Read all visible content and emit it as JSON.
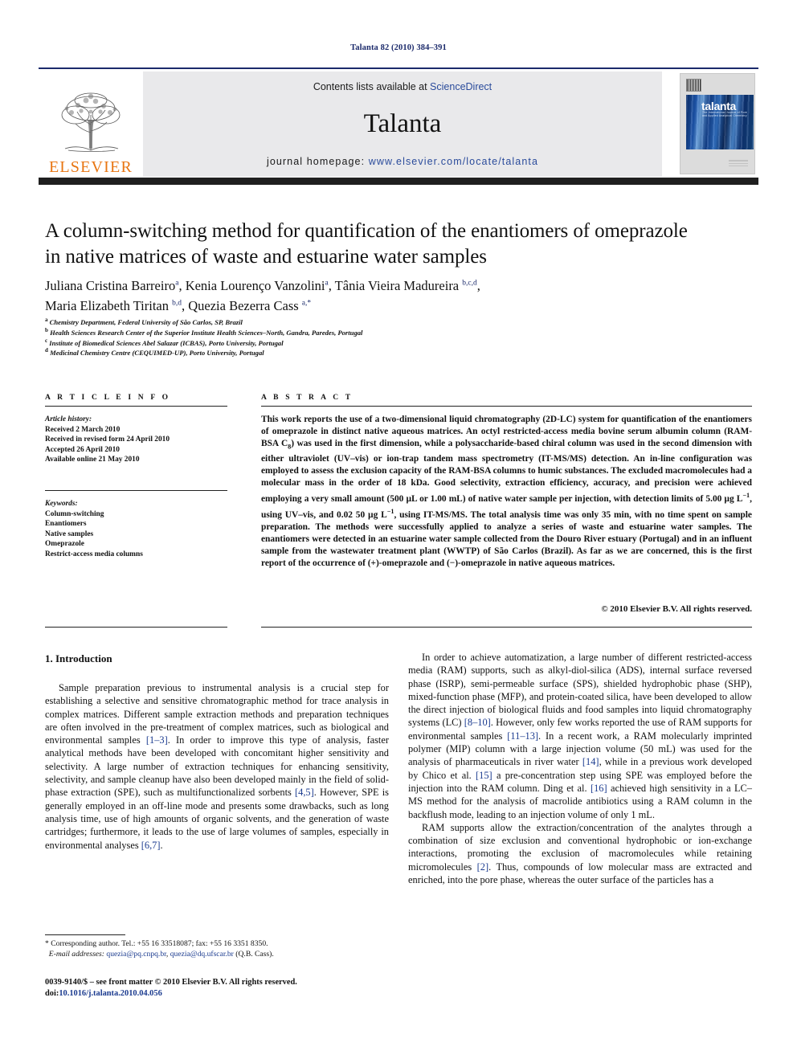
{
  "running_head": "Talanta 82 (2010) 384–391",
  "masthead": {
    "publisher": "ELSEVIER",
    "contents_prefix": "Contents lists available at ",
    "contents_link": "ScienceDirect",
    "journal_name": "Talanta",
    "homepage_prefix": "journal homepage: ",
    "homepage_url": "www.elsevier.com/locate/talanta",
    "cover_title": "talanta",
    "cover_subtitle": "The International Journal of Pure and Applied Analytical Chemistry"
  },
  "article": {
    "title_line1": "A column-switching method for quantification of the enantiomers of omeprazole",
    "title_line2": "in native matrices of waste and estuarine water samples",
    "authors": [
      {
        "name": "Juliana Cristina Barreiro",
        "marks": "a"
      },
      {
        "name": "Kenia Lourenço Vanzolini",
        "marks": "a"
      },
      {
        "name": "Tânia Vieira Madureira",
        "marks": "b,c,d"
      },
      {
        "name": "Maria Elizabeth Tiritan",
        "marks": "b,d"
      },
      {
        "name": "Quezia Bezerra Cass",
        "marks": "a,*"
      }
    ],
    "affiliations": [
      {
        "mark": "a",
        "text": "Chemistry Department, Federal University of São Carlos, SP, Brazil"
      },
      {
        "mark": "b",
        "text": "Health Sciences Research Center of the Superior Institute Health Sciences–North, Gandra, Paredes, Portugal"
      },
      {
        "mark": "c",
        "text": "Institute of Biomedical Sciences Abel Salazar (ICBAS), Porto University, Portugal"
      },
      {
        "mark": "d",
        "text": "Medicinal Chemistry Centre (CEQUIMED-UP), Porto University, Portugal"
      }
    ]
  },
  "info": {
    "heading_article_info": "A R T I C L E   I N F O",
    "heading_abstract": "A B S T R A C T",
    "history_label": "Article history:",
    "history": [
      "Received 2 March 2010",
      "Received in revised form 24 April 2010",
      "Accepted 26 April 2010",
      "Available online 21 May 2010"
    ],
    "keywords_label": "Keywords:",
    "keywords": [
      "Column-switching",
      "Enantiomers",
      "Native samples",
      "Omeprazole",
      "Restrict-access media columns"
    ]
  },
  "abstract": {
    "text": "This work reports the use of a two-dimensional liquid chromatography (2D-LC) system for quantification of the enantiomers of omeprazole in distinct native aqueous matrices. An octyl restricted-access media bovine serum albumin column (RAM-BSA C8) was used in the first dimension, while a polysaccharide-based chiral column was used in the second dimension with either ultraviolet (UV–vis) or ion-trap tandem mass spectrometry (IT-MS/MS) detection. An in-line configuration was employed to assess the exclusion capacity of the RAM-BSA columns to humic substances. The excluded macromolecules had a molecular mass in the order of 18 kDa. Good selectivity, extraction efficiency, accuracy, and precision were achieved employing a very small amount (500 µL or 1.00 mL) of native water sample per injection, with detection limits of 5.00 µg L−1, using UV–vis, and 0.02 50 µg L−1, using IT-MS/MS. The total analysis time was only 35 min, with no time spent on sample preparation. The methods were successfully applied to analyze a series of waste and estuarine water samples. The enantiomers were detected in an estuarine water sample collected from the Douro River estuary (Portugal) and in an influent sample from the wastewater treatment plant (WWTP) of São Carlos (Brazil). As far as we are concerned, this is the first report of the occurrence of (+)-omeprazole and (−)-omeprazole in native aqueous matrices.",
    "copyright": "© 2010 Elsevier B.V. All rights reserved."
  },
  "body": {
    "section_number_title": "1.  Introduction",
    "left_paragraphs": [
      "Sample preparation previous to instrumental analysis is a crucial step for establishing a selective and sensitive chromatographic method for trace analysis in complex matrices. Different sample extraction methods and preparation techniques are often involved in the pre-treatment of complex matrices, such as biological and environmental samples [1–3]. In order to improve this type of analysis, faster analytical methods have been developed with concomitant higher sensitivity and selectivity. A large number of extraction techniques for enhancing sensitivity, selectivity, and sample cleanup have also been developed mainly in the field of solid-phase extraction (SPE), such as multifunctionalized sorbents [4,5]. However, SPE is generally employed in an off-line mode and presents some drawbacks, such as long analysis time, use of high amounts of organic solvents, and the generation of waste cartridges; furthermore, it leads to the use of large volumes of samples, especially in environmental analyses [6,7]."
    ],
    "right_paragraphs": [
      "In order to achieve automatization, a large number of different restricted-access media (RAM) supports, such as alkyl-diol-silica (ADS), internal surface reversed phase (ISRP), semi-permeable surface (SPS), shielded hydrophobic phase (SHP), mixed-function phase (MFP), and protein-coated silica, have been developed to allow the direct injection of biological fluids and food samples into liquid chromatography systems (LC) [8–10]. However, only few works reported the use of RAM supports for environmental samples [11–13]. In a recent work, a RAM molecularly imprinted polymer (MIP) column with a large injection volume (50 mL) was used for the analysis of pharmaceuticals in river water [14], while in a previous work developed by Chico et al. [15] a pre-concentration step using SPE was employed before the injection into the RAM column. Ding et al. [16] achieved high sensitivity in a LC–MS method for the analysis of macrolide antibiotics using a RAM column in the backflush mode, leading to an injection volume of only 1 mL.",
      "RAM supports allow the extraction/concentration of the analytes through a combination of size exclusion and conventional hydrophobic or ion-exchange interactions, promoting the exclusion of macromolecules while retaining micromolecules [2]. Thus, compounds of low molecular mass are extracted and enriched, into the pore phase, whereas the outer surface of the particles has a"
    ]
  },
  "footer": {
    "corresponding": "* Corresponding author. Tel.: +55 16 33518087; fax: +55 16 3351 8350.",
    "email_label": "E-mail addresses:",
    "email_1": "quezia@pq.cnpq.br",
    "email_2": "quezia@dq.ufscar.br",
    "email_suffix": "(Q.B. Cass).",
    "issn_line": "0039-9140/$ – see front matter © 2010 Elsevier B.V. All rights reserved.",
    "doi_prefix": "doi:",
    "doi": "10.1016/j.talanta.2010.04.056"
  },
  "colors": {
    "link": "#1b3b8f",
    "running_head": "#1b2a6b",
    "elsevier_orange": "#E87511",
    "band": "#1f1f1f",
    "masthead_bg": "#e9e9eb"
  }
}
